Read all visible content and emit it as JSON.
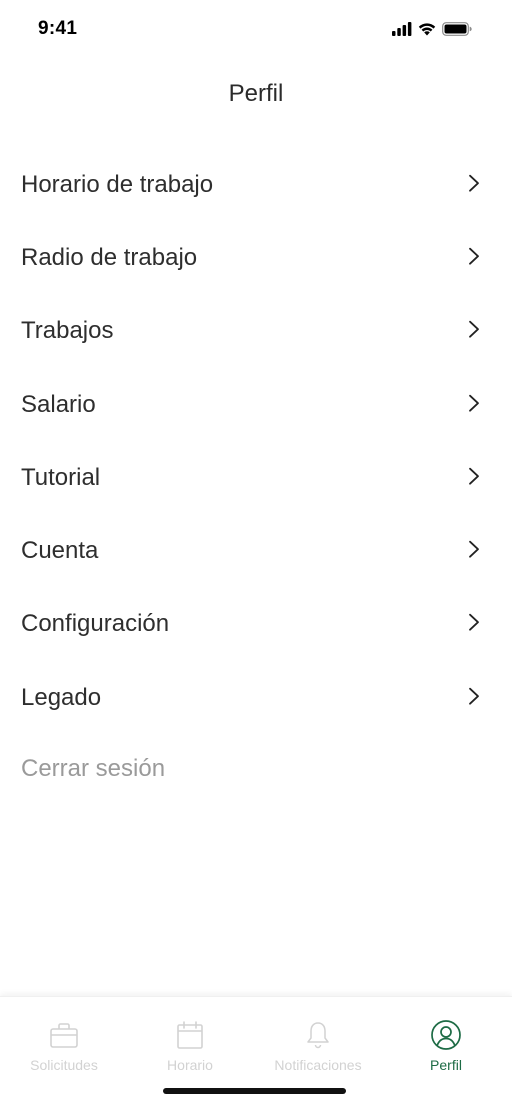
{
  "status_bar": {
    "time": "9:41",
    "icons": [
      "signal-icon",
      "wifi-icon",
      "battery-icon"
    ]
  },
  "header": {
    "title": "Perfil"
  },
  "menu": {
    "items": [
      {
        "label": "Horario de trabajo",
        "icon": "chevron-right-icon"
      },
      {
        "label": "Radio de trabajo",
        "icon": "chevron-right-icon"
      },
      {
        "label": "Trabajos",
        "icon": "chevron-right-icon"
      },
      {
        "label": "Salario",
        "icon": "chevron-right-icon"
      },
      {
        "label": "Tutorial",
        "icon": "chevron-right-icon"
      },
      {
        "label": "Cuenta",
        "icon": "chevron-right-icon"
      },
      {
        "label": "Configuración",
        "icon": "chevron-right-icon"
      },
      {
        "label": "Legado",
        "icon": "chevron-right-icon"
      }
    ],
    "logout_label": "Cerrar sesión"
  },
  "tab_bar": {
    "tabs": [
      {
        "label": "Solicitudes",
        "icon": "briefcase-icon",
        "active": false
      },
      {
        "label": "Horario",
        "icon": "calendar-icon",
        "active": false
      },
      {
        "label": "Notificaciones",
        "icon": "bell-icon",
        "active": false
      },
      {
        "label": "Perfil",
        "icon": "profile-icon",
        "active": true
      }
    ]
  },
  "colors": {
    "accent": "#1d6b45",
    "inactive_tab": "#d2d2d2",
    "text": "#2e2e2e",
    "muted_text": "#9a9a9a"
  }
}
